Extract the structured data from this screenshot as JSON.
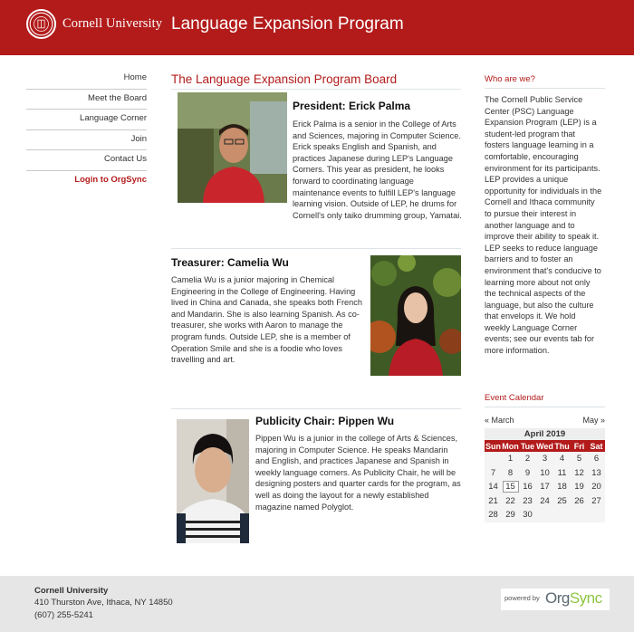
{
  "header": {
    "university": "Cornell University",
    "program_title": "Language Expansion Program"
  },
  "nav": {
    "items": [
      "Home",
      "Meet the Board",
      "Language Corner",
      "Join",
      "Contact Us"
    ],
    "login": "Login to OrgSync"
  },
  "main": {
    "title": "The Language Expansion Program Board",
    "bios": [
      {
        "name": "President: Erick Palma",
        "text": "Erick Palma is a senior in the College of Arts and Sciences, majoring in Computer Science. Erick speaks English and Spanish, and practices Japanese during LEP's Language Corners. This year as president, he looks forward to coordinating language maintenance events to fulfill LEP's language learning vision. Outside of LEP, he drums for Cornell's only taiko drumming group, Yamatai."
      },
      {
        "name": "Treasurer: Camelia Wu",
        "text": "Camelia Wu is a junior majoring in Chemical Engineering in the College of Engineering. Having lived in China and Canada, she speaks both French and Mandarin. She is also learning Spanish. As co-treasurer, she works with Aaron to manage the program funds. Outside LEP, she is a member of Operation Smile and she is a foodie who loves travelling and art."
      },
      {
        "name": "Publicity Chair: Pippen Wu",
        "text": "Pippen Wu is a junior in the college of Arts & Sciences, majoring in Computer Science. He speaks Mandarin and English, and practices Japanese and Spanish in weekly language corners. As Publicity Chair, he will be designing posters and quarter cards for the program, as well as doing the layout for a newly established magazine named Polyglot."
      }
    ]
  },
  "sidebar": {
    "about_heading": "Who are we?",
    "about_text": "The Cornell Public Service Center (PSC) Language Expansion Program (LEP) is a student-led program that fosters language learning in a comfortable, encouraging environment for its participants. LEP provides a unique opportunity for individuals in the Cornell and Ithaca community to pursue their interest in another language and to improve their ability to speak it. LEP seeks to reduce language barriers and to foster an environment that's conducive to learning more about not only the technical aspects of the language, but also the culture that envelops it. We hold weekly Language Corner events; see our events tab for more information.",
    "calendar_heading": "Event Calendar",
    "calendar": {
      "prev": "« March",
      "next": "May »",
      "month": "April 2019",
      "weekdays": [
        "Sun",
        "Mon",
        "Tue",
        "Wed",
        "Thu",
        "Fri",
        "Sat"
      ],
      "weeks": [
        [
          "",
          "1",
          "2",
          "3",
          "4",
          "5",
          "6"
        ],
        [
          "7",
          "8",
          "9",
          "10",
          "11",
          "12",
          "13"
        ],
        [
          "14",
          "15",
          "16",
          "17",
          "18",
          "19",
          "20"
        ],
        [
          "21",
          "22",
          "23",
          "24",
          "25",
          "26",
          "27"
        ],
        [
          "28",
          "29",
          "30",
          "",
          "",
          "",
          ""
        ]
      ],
      "today": "15"
    }
  },
  "footer": {
    "org": "Cornell University",
    "address": "410 Thurston Ave, Ithaca, NY 14850",
    "phone": "(607) 255-5241",
    "powered_label": "powered by",
    "brand_a": "Org",
    "brand_b": "Sync"
  },
  "colors": {
    "brand_red": "#b31b1b",
    "orgsync_green": "#8cc63f"
  }
}
